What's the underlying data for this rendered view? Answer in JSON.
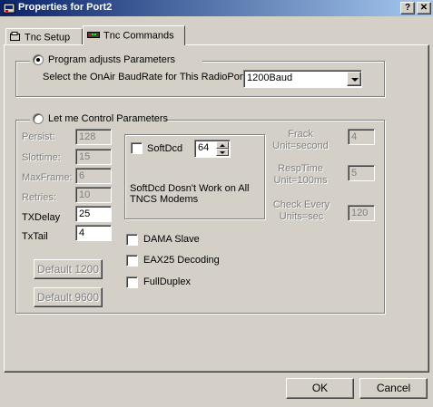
{
  "window": {
    "title": "Properties for Port2",
    "help_label": "?",
    "close_label": "✕",
    "icon": "app-window-icon"
  },
  "tabs": [
    {
      "label": "Tnc Setup",
      "icon": "tnc-setup-icon",
      "active": false
    },
    {
      "label": "Tnc Commands",
      "icon": "tnc-commands-icon",
      "active": true
    }
  ],
  "program_group": {
    "radio_label": "Program adjusts Parameters",
    "selected": true,
    "baud_prompt": "Select the OnAir BaudRate for This RadioPort",
    "baud_value": "1200Baud"
  },
  "manual_group": {
    "radio_label": "Let me Control Parameters",
    "selected": false,
    "params": [
      {
        "label": "Persist:",
        "value": "128",
        "enabled": false
      },
      {
        "label": "Slottime:",
        "value": "15",
        "enabled": false
      },
      {
        "label": "MaxFrame:",
        "value": "6",
        "enabled": false
      },
      {
        "label": "Retries:",
        "value": "10",
        "enabled": false
      },
      {
        "label": "TXDelay",
        "value": "25",
        "enabled": true
      },
      {
        "label": "TxTail",
        "value": "4",
        "enabled": true
      }
    ],
    "softdcd": {
      "label": "SoftDcd",
      "checked": false,
      "value": "64",
      "note": "SoftDcd Dosn't Work on All TNCS  Modems"
    },
    "options": [
      {
        "label": "DAMA Slave",
        "checked": false
      },
      {
        "label": "EAX25 Decoding",
        "checked": false
      },
      {
        "label": "FullDuplex",
        "checked": false
      }
    ],
    "default_1200_label": "Default 1200",
    "default_9600_label": "Default 9600",
    "frack": {
      "label_line1": "Frack",
      "label_line2": "Unit=second",
      "value": "4"
    },
    "resptime": {
      "label_line1": "RespTime",
      "label_line2": "Unit=100ms",
      "value": "5"
    },
    "check": {
      "label_line1": "Check Every",
      "label_line2": "Units=sec",
      "value": "120"
    }
  },
  "footer": {
    "ok_label": "OK",
    "cancel_label": "Cancel"
  }
}
